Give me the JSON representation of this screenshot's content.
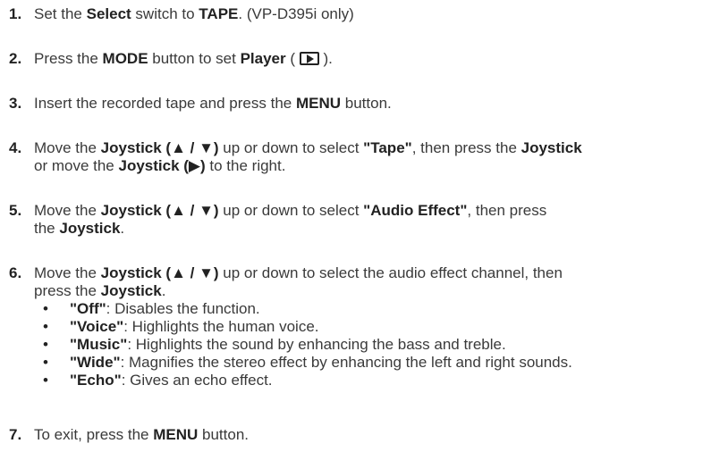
{
  "steps": {
    "s1": {
      "num": "1.",
      "t1": "Set the ",
      "b1": "Select",
      "t2": " switch to ",
      "b2": "TAPE",
      "t3": ". (VP-D395i only)"
    },
    "s2": {
      "num": "2.",
      "t1": "Press the ",
      "b1": "MODE",
      "t2": " button to set ",
      "b2": "Player",
      "t3": " ( ",
      "t4": " )."
    },
    "s3": {
      "num": "3.",
      "t1": "Insert the recorded tape and press the ",
      "b1": "MENU",
      "t2": " button."
    },
    "s4": {
      "num": "4.",
      "t1": "Move the ",
      "b1": "Joystick (▲ / ▼)",
      "t2": " up or down to select ",
      "b2": "\"Tape\"",
      "t3": ", then press the ",
      "b3": "Joystick",
      "t4": "or move the ",
      "b4": "Joystick (▶)",
      "t5": " to the right."
    },
    "s5": {
      "num": "5.",
      "t1": "Move the ",
      "b1": "Joystick (▲ / ▼)",
      "t2": " up or down to select ",
      "b2": "\"Audio Effect\"",
      "t3": ", then press",
      "t4": "the ",
      "b3": "Joystick",
      "t5": "."
    },
    "s6": {
      "num": "6.",
      "t1": "Move the ",
      "b1": "Joystick (▲ / ▼)",
      "t2": " up or down to select the audio effect channel, then",
      "t3": "press the ",
      "b2": "Joystick",
      "t4": ".",
      "options": [
        {
          "name": "\"Off\"",
          "desc": ": Disables the function."
        },
        {
          "name": "\"Voice\"",
          "desc": ": Highlights the human voice."
        },
        {
          "name": "\"Music\"",
          "desc": ": Highlights the sound by enhancing the bass and treble."
        },
        {
          "name": "\"Wide\"",
          "desc": ": Magnifies the stereo effect by enhancing the left and right sounds."
        },
        {
          "name": "\"Echo\"",
          "desc": ": Gives an echo effect."
        }
      ]
    },
    "s7": {
      "num": "7.",
      "t1": "To exit, press the ",
      "b1": "MENU",
      "t2": " button."
    }
  },
  "icons": {
    "player": "player-icon"
  }
}
